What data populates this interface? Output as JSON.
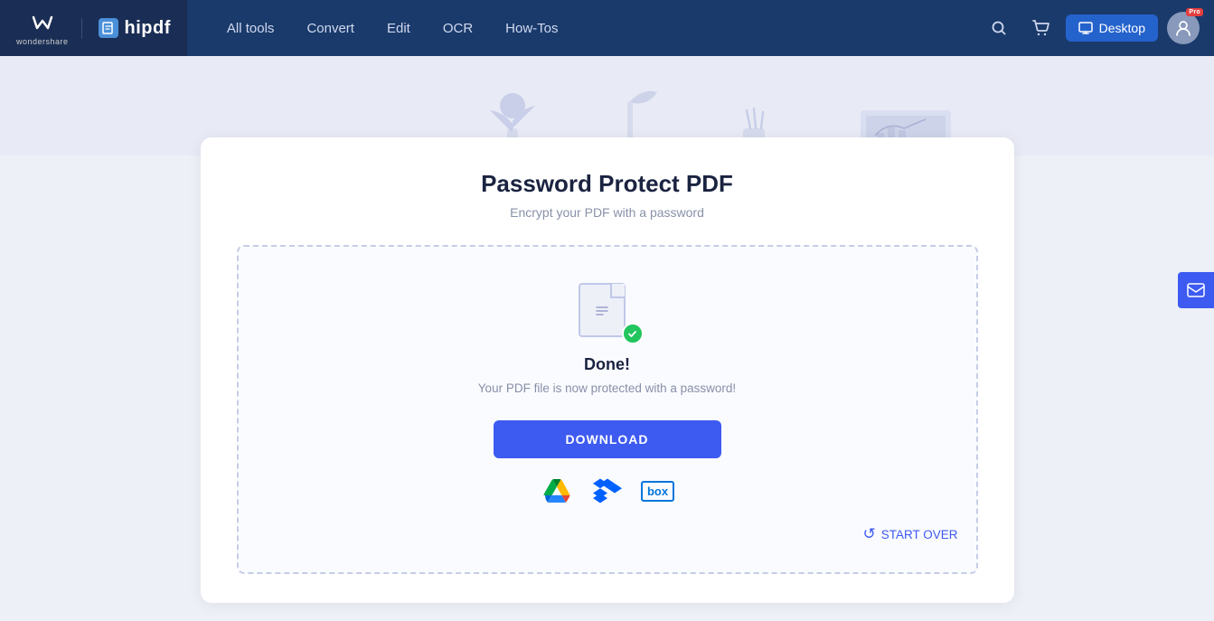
{
  "brand": {
    "wondershare": "wondershare",
    "hipdf": "hipdf"
  },
  "nav": {
    "all_tools": "All tools",
    "convert": "Convert",
    "edit": "Edit",
    "ocr": "OCR",
    "how_tos": "How-Tos",
    "desktop_btn": "Desktop",
    "pro_badge": "Pro"
  },
  "page": {
    "title": "Password Protect PDF",
    "subtitle": "Encrypt your PDF with a password"
  },
  "done_area": {
    "done_label": "Done!",
    "done_desc": "Your PDF file is now protected with a password!",
    "download_btn": "DOWNLOAD",
    "start_over": "START OVER"
  },
  "cloud": {
    "gdrive_label": "Google Drive",
    "dropbox_label": "Dropbox",
    "box_label": "box"
  }
}
